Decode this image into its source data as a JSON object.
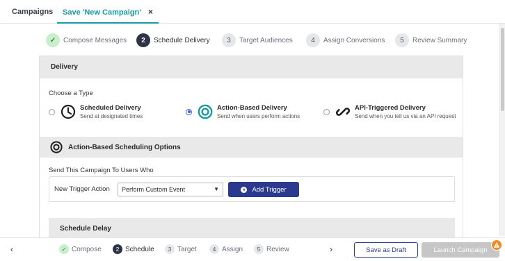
{
  "tabs": {
    "campaigns": "Campaigns",
    "active": "Save 'New Campaign'",
    "close_glyph": "×"
  },
  "stepper": [
    {
      "num": "✓",
      "label": "Compose Messages",
      "state": "done"
    },
    {
      "num": "2",
      "label": "Schedule Delivery",
      "state": "current"
    },
    {
      "num": "3",
      "label": "Target Audiences",
      "state": "pending"
    },
    {
      "num": "4",
      "label": "Assign Conversions",
      "state": "pending"
    },
    {
      "num": "5",
      "label": "Review Summary",
      "state": "pending"
    }
  ],
  "delivery": {
    "header": "Delivery",
    "choose_label": "Choose a Type",
    "options": [
      {
        "title": "Scheduled Delivery",
        "subtitle": "Send at designated times",
        "icon": "clock-icon",
        "selected": false
      },
      {
        "title": "Action-Based Delivery",
        "subtitle": "Send when users perform actions",
        "icon": "target-icon",
        "selected": true
      },
      {
        "title": "API-Triggered Delivery",
        "subtitle": "Send when you tell us via an API request",
        "icon": "link-icon",
        "selected": false
      }
    ]
  },
  "scheduling": {
    "header": "Action-Based Scheduling Options",
    "send_label": "Send This Campaign To Users Who",
    "trigger_label": "New Trigger Action",
    "trigger_select_value": "Perform Custom Event",
    "add_trigger_label": "Add Trigger"
  },
  "schedule_delay": {
    "header": "Schedule Delay"
  },
  "bottom": {
    "prev_glyph": "‹",
    "next_glyph": "›",
    "steps": [
      {
        "num": "✓",
        "label": "Compose",
        "state": "done"
      },
      {
        "num": "2",
        "label": "Schedule",
        "state": "current"
      },
      {
        "num": "3",
        "label": "Target",
        "state": "pending"
      },
      {
        "num": "4",
        "label": "Assign",
        "state": "pending"
      },
      {
        "num": "5",
        "label": "Review",
        "state": "pending"
      }
    ],
    "save_draft_label": "Save as Draft",
    "launch_label": "Launch Campaign"
  },
  "colors": {
    "accent_teal": "#1a9aa0",
    "primary_navy": "#2b3a8f",
    "radio_blue": "#2f62d4",
    "warning_orange": "#f08a24"
  }
}
